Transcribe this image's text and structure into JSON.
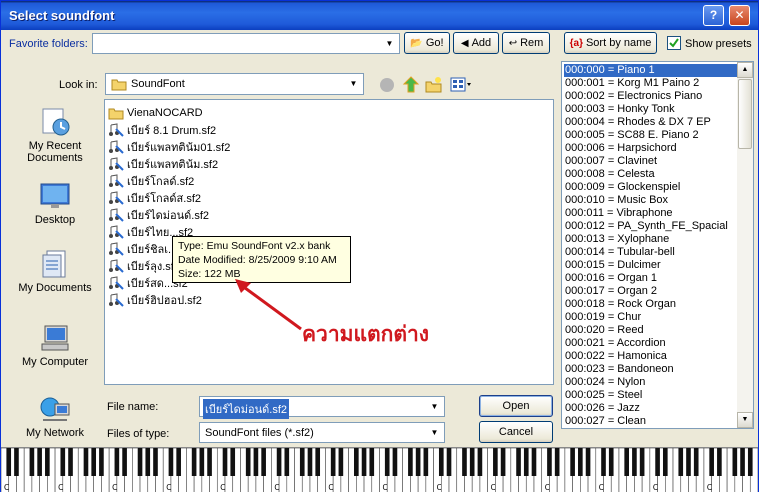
{
  "window": {
    "title": "Select soundfont",
    "help_label": "?",
    "close_label": "✕"
  },
  "favorites": {
    "label": "Favorite folders:",
    "value": "",
    "go_label": "Go!",
    "add_label": "Add",
    "rem_label": "Rem"
  },
  "sort_button": {
    "label": "Sort by name",
    "icon_text": "{a}"
  },
  "show_presets": {
    "label": "Show presets",
    "checked": true
  },
  "lookin": {
    "label": "Look in:",
    "value": "SoundFont"
  },
  "places": [
    {
      "id": "recent",
      "label": "My Recent Documents"
    },
    {
      "id": "desktop",
      "label": "Desktop"
    },
    {
      "id": "documents",
      "label": "My Documents"
    },
    {
      "id": "computer",
      "label": "My Computer"
    },
    {
      "id": "network",
      "label": "My Network"
    }
  ],
  "files": [
    {
      "name": "VienaNOCARD",
      "type": "folder"
    },
    {
      "name": "เบียร์ 8.1 Drum.sf2",
      "type": "sf2"
    },
    {
      "name": "เบียร์แพลทติน้ม01.sf2",
      "type": "sf2"
    },
    {
      "name": "เบียร์แพลทติน้ม.sf2",
      "type": "sf2"
    },
    {
      "name": "เบียร์โกลด์.sf2",
      "type": "sf2"
    },
    {
      "name": "เบียร์โกลด์ส.sf2",
      "type": "sf2"
    },
    {
      "name": "เบียร์ไดม่อนด์.sf2",
      "type": "sf2"
    },
    {
      "name": "เบียร์ไทย...sf2",
      "type": "sf2"
    },
    {
      "name": "เบียร์ชิลเ...",
      "type": "sf2"
    },
    {
      "name": "เบียร์ลุง.sf...",
      "type": "sf2"
    },
    {
      "name": "เบียร์สด...sf2",
      "type": "sf2"
    },
    {
      "name": "เบียร์ฮิปฮอป.sf2",
      "type": "sf2"
    }
  ],
  "tooltip": {
    "type_line": "Type: Emu SoundFont v2.x bank",
    "date_line": "Date Modified: 8/25/2009 9:10 AM",
    "size_line": "Size: 122 MB"
  },
  "annotation": "ความแตกต่าง",
  "filename": {
    "label": "File name:",
    "value": "เบียร์ไดม่อนด์.sf2"
  },
  "filetype": {
    "label": "Files of type:",
    "value": "SoundFont files (*.sf2)"
  },
  "open_label": "Open",
  "cancel_label": "Cancel",
  "presets": [
    "000:000 = Piano 1",
    "000:001 = Korg M1 Paino 2",
    "000:002 = Electronics Piano",
    "000:003 = Honky Tonk",
    "000:004 = Rhodes & DX 7 EP",
    "000:005 = SC88 E. Piano 2",
    "000:006 = Harpsichord",
    "000:007 = Clavinet",
    "000:008 = Celesta",
    "000:009 = Glockenspiel",
    "000:010 = Music Box",
    "000:011 = Vibraphone",
    "000:012 = PA_Synth_FE_Spacial",
    "000:013 = Xylophane",
    "000:014 = Tubular-bell",
    "000:015 = Dulcimer",
    "000:016 = Organ 1",
    "000:017 = Organ 2",
    "000:018 = Rock Organ",
    "000:019 = Chur",
    "000:020 = Reed",
    "000:021 = Accordion",
    "000:022 = Hamonica",
    "000:023 = Bandoneon",
    "000:024 = Nylon",
    "000:025 = Steel",
    "000:026 = Jazz",
    "000:027 = Clean"
  ],
  "selected_preset": 0,
  "keyboard_c_label": "C",
  "keyboard_c_count": 14
}
